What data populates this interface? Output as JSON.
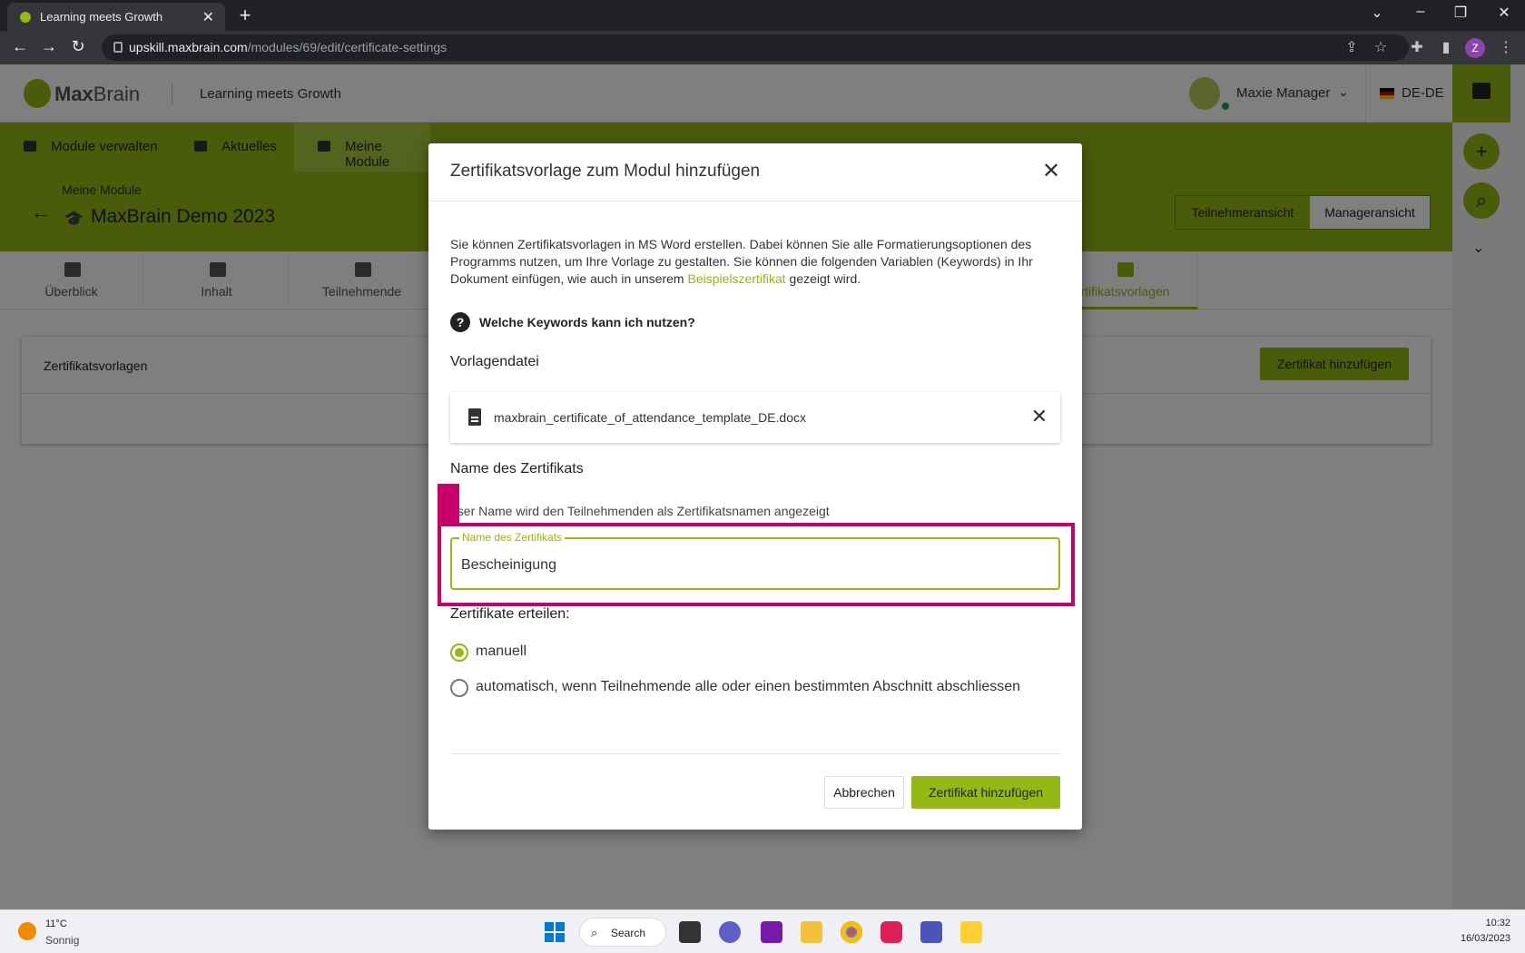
{
  "browser": {
    "tab_title": "Learning meets Growth",
    "url_host": "upskill.maxbrain.com",
    "url_path": "/modules/69/edit/certificate-settings",
    "profile_initial": "Z"
  },
  "app": {
    "logo_bold": "Max",
    "logo_light": "Brain",
    "tagline": "Learning meets Growth",
    "user_name": "Maxie Manager",
    "language": "DE-DE"
  },
  "mainnav": {
    "items": [
      {
        "label": "Module verwalten"
      },
      {
        "label": "Aktuelles"
      },
      {
        "label": "Meine Module"
      }
    ]
  },
  "subhead": {
    "crumb": "Meine Module",
    "module_title": "MaxBrain Demo 2023",
    "view_participant": "Teilnehmeransicht",
    "view_manager": "Manageransicht"
  },
  "content_tabs": [
    {
      "label": "Überblick"
    },
    {
      "label": "Inhalt"
    },
    {
      "label": "Teilnehmende"
    },
    {
      "label": "rtifikatsvorlagen"
    }
  ],
  "card": {
    "title": "Zertifikatsvorlagen",
    "add_button": "Zertifikat hinzufügen"
  },
  "modal": {
    "title": "Zertifikatsvorlage zum Modul hinzufügen",
    "intro_text": "Sie können Zertifikatsvorlagen in MS Word erstellen. Dabei können Sie alle Formatierungsoptionen des Programms nutzen, um Ihre Vorlage zu gestalten. Sie können die folgenden Variablen (Keywords) in Ihr Dokument einfügen, wie auch in unserem ",
    "intro_link": "Beispielszertifikat",
    "intro_tail": " gezeigt wird.",
    "help_text": "Welche Keywords kann ich nutzen?",
    "template_label": "Vorlagendatei",
    "file_name": "maxbrain_certificate_of_attendance_template_DE.docx",
    "name_section_label": "Name des Zertifikats",
    "name_section_desc": "eser Name wird den Teilnehmenden als Zertifikatsnamen angezeigt",
    "name_field_label": "Name des Zertifikats",
    "name_field_value": "Bescheinigung",
    "issue_label": "Zertifikate erteilen:",
    "radio_manual": "manuell",
    "radio_auto": "automatisch, wenn Teilnehmende alle oder einen bestimmten Abschnitt abschliessen",
    "selected_option": "manuell",
    "cancel_button": "Abbrechen",
    "add_button": "Zertifikat hinzufügen"
  },
  "taskbar": {
    "temperature": "11°C",
    "weather": "Sonnig",
    "search_label": "Search",
    "time": "10:32",
    "date": "16/03/2023"
  },
  "colors": {
    "brand_green": "#94b814",
    "highlight_magenta": "#c8006a"
  }
}
